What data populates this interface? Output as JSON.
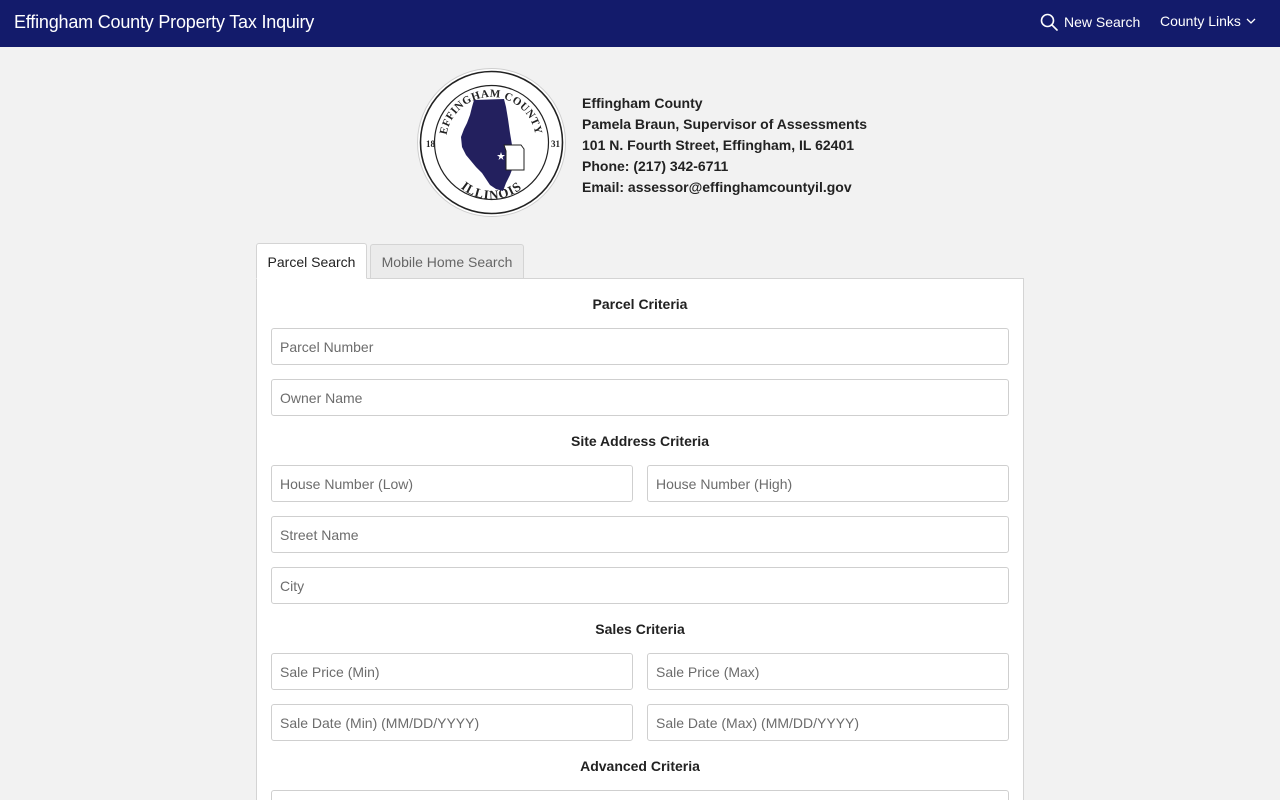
{
  "navbar": {
    "title": "Effingham County Property Tax Inquiry",
    "new_search_label": "New Search",
    "county_links_label": "County Links"
  },
  "seal": {
    "top_text": "EFFINGHAM COUNTY",
    "bottom_text": "ILLINOIS",
    "year_left": "18",
    "year_right": "31"
  },
  "contact": {
    "county": "Effingham County",
    "supervisor": "Pamela Braun, Supervisor of Assessments",
    "address": "101 N. Fourth Street, Effingham, IL 62401",
    "phone": "Phone: (217) 342-6711",
    "email": "Email: assessor@effinghamcountyil.gov"
  },
  "tabs": [
    {
      "label": "Parcel Search",
      "active": true
    },
    {
      "label": "Mobile Home Search",
      "active": false
    }
  ],
  "form": {
    "parcel_criteria": {
      "title": "Parcel Criteria",
      "parcel_number_placeholder": "Parcel Number",
      "owner_name_placeholder": "Owner Name"
    },
    "site_address_criteria": {
      "title": "Site Address Criteria",
      "house_low_placeholder": "House Number (Low)",
      "house_high_placeholder": "House Number (High)",
      "street_name_placeholder": "Street Name",
      "city_placeholder": "City"
    },
    "sales_criteria": {
      "title": "Sales Criteria",
      "price_min_placeholder": "Sale Price (Min)",
      "price_max_placeholder": "Sale Price (Max)",
      "date_min_placeholder": "Sale Date (Min) (MM/DD/YYYY)",
      "date_max_placeholder": "Sale Date (Max) (MM/DD/YYYY)"
    },
    "advanced_criteria": {
      "title": "Advanced Criteria"
    }
  },
  "colors": {
    "navbar": "#131b6b",
    "seal_state": "#23205e",
    "background": "#f2f2f2"
  }
}
